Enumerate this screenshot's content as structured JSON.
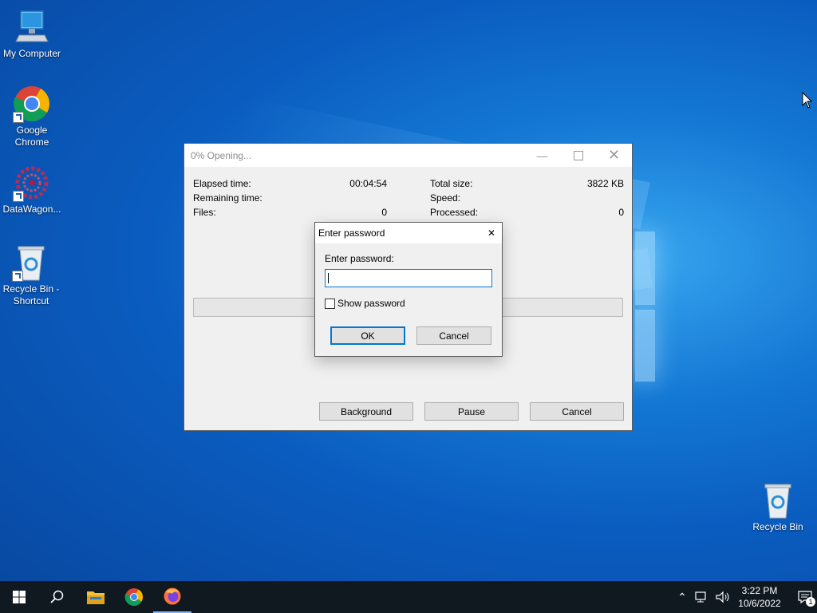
{
  "desktop": {
    "icons": [
      {
        "label": "My Computer"
      },
      {
        "label": "Google Chrome"
      },
      {
        "label": "DataWagon..."
      },
      {
        "label": "Recycle Bin - Shortcut"
      },
      {
        "label": "Recycle Bin"
      }
    ]
  },
  "window": {
    "title": "0% Opening...",
    "progress_percent": 0,
    "stats": {
      "elapsed_label": "Elapsed time:",
      "elapsed_value": "00:04:54",
      "remaining_label": "Remaining time:",
      "remaining_value": "",
      "files_label": "Files:",
      "files_value": "0",
      "total_label": "Total size:",
      "total_value": "3822 KB",
      "speed_label": "Speed:",
      "speed_value": "",
      "processed_label": "Processed:",
      "processed_value": "0"
    },
    "buttons": {
      "background": "Background",
      "pause": "Pause",
      "cancel": "Cancel"
    }
  },
  "dialog": {
    "title": "Enter password",
    "prompt": "Enter password:",
    "password_value": "",
    "show_password_label": "Show password",
    "show_password_checked": false,
    "ok": "OK",
    "cancel": "Cancel"
  },
  "taskbar": {
    "time": "3:22 PM",
    "date": "10/6/2022",
    "notification_count": "1"
  },
  "colors": {
    "accent": "#0078d7",
    "desktop": "#0a5cbf",
    "taskbar": "#101820"
  }
}
